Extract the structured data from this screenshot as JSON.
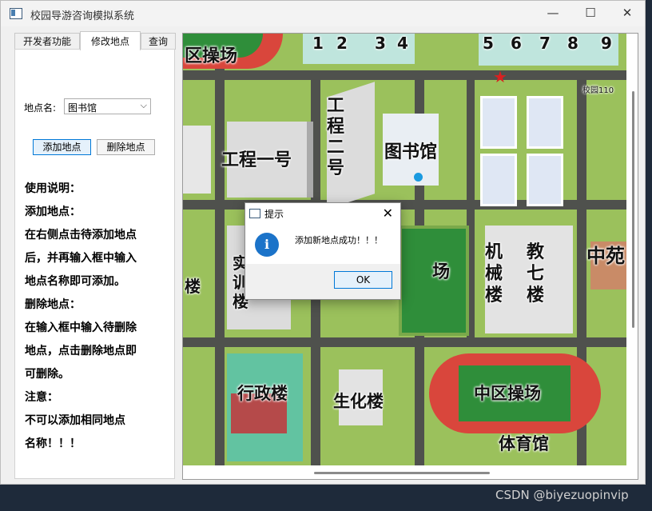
{
  "window": {
    "title": "校园导游咨询模拟系统",
    "controls": {
      "minimize": "—",
      "maximize": "☐",
      "close": "✕"
    }
  },
  "tabs": [
    {
      "label": "开发者功能"
    },
    {
      "label": "修改地点"
    },
    {
      "label": "查询"
    }
  ],
  "panel": {
    "place_label": "地点名:",
    "place_value": "图书馆",
    "add_button": "添加地点",
    "delete_button": "删除地点",
    "help": [
      "使用说明：",
      "添加地点：",
      "在右侧点击待添加地点",
      "后，并再输入框中输入",
      "地点名称即可添加。",
      "删除地点：",
      "在输入框中输入待删除",
      "地点，点击删除地点即",
      "可删除。",
      "注意：",
      "不可以添加相同地点",
      "名称！！！"
    ]
  },
  "map": {
    "labels": {
      "district_sports_top": "区操场",
      "engineering_one": "工程一号",
      "engineering_two": "工程二号",
      "library": "图书馆",
      "mech": "机械楼",
      "teach_seven": "教七楼",
      "zhongyuan": "中苑",
      "admin": "行政楼",
      "bio": "生化楼",
      "central_sports": "中区操场",
      "gym": "体育馆",
      "field_char": "场",
      "shi": "实训楼",
      "lou_left": "楼",
      "school_gate": "校园110",
      "numbers": [
        "1",
        "2",
        "3",
        "4",
        "5",
        "6",
        "7",
        "8",
        "9"
      ]
    },
    "colors": {
      "grass": "#9bc15c",
      "road": "#4f514d",
      "track": "#d9463c",
      "field": "#2f8e3a"
    }
  },
  "dialog": {
    "title": "提示",
    "message": "添加新地点成功！！！",
    "ok": "OK",
    "icon": "i",
    "close": "✕"
  },
  "watermark": "CSDN @biyezuopinvip"
}
